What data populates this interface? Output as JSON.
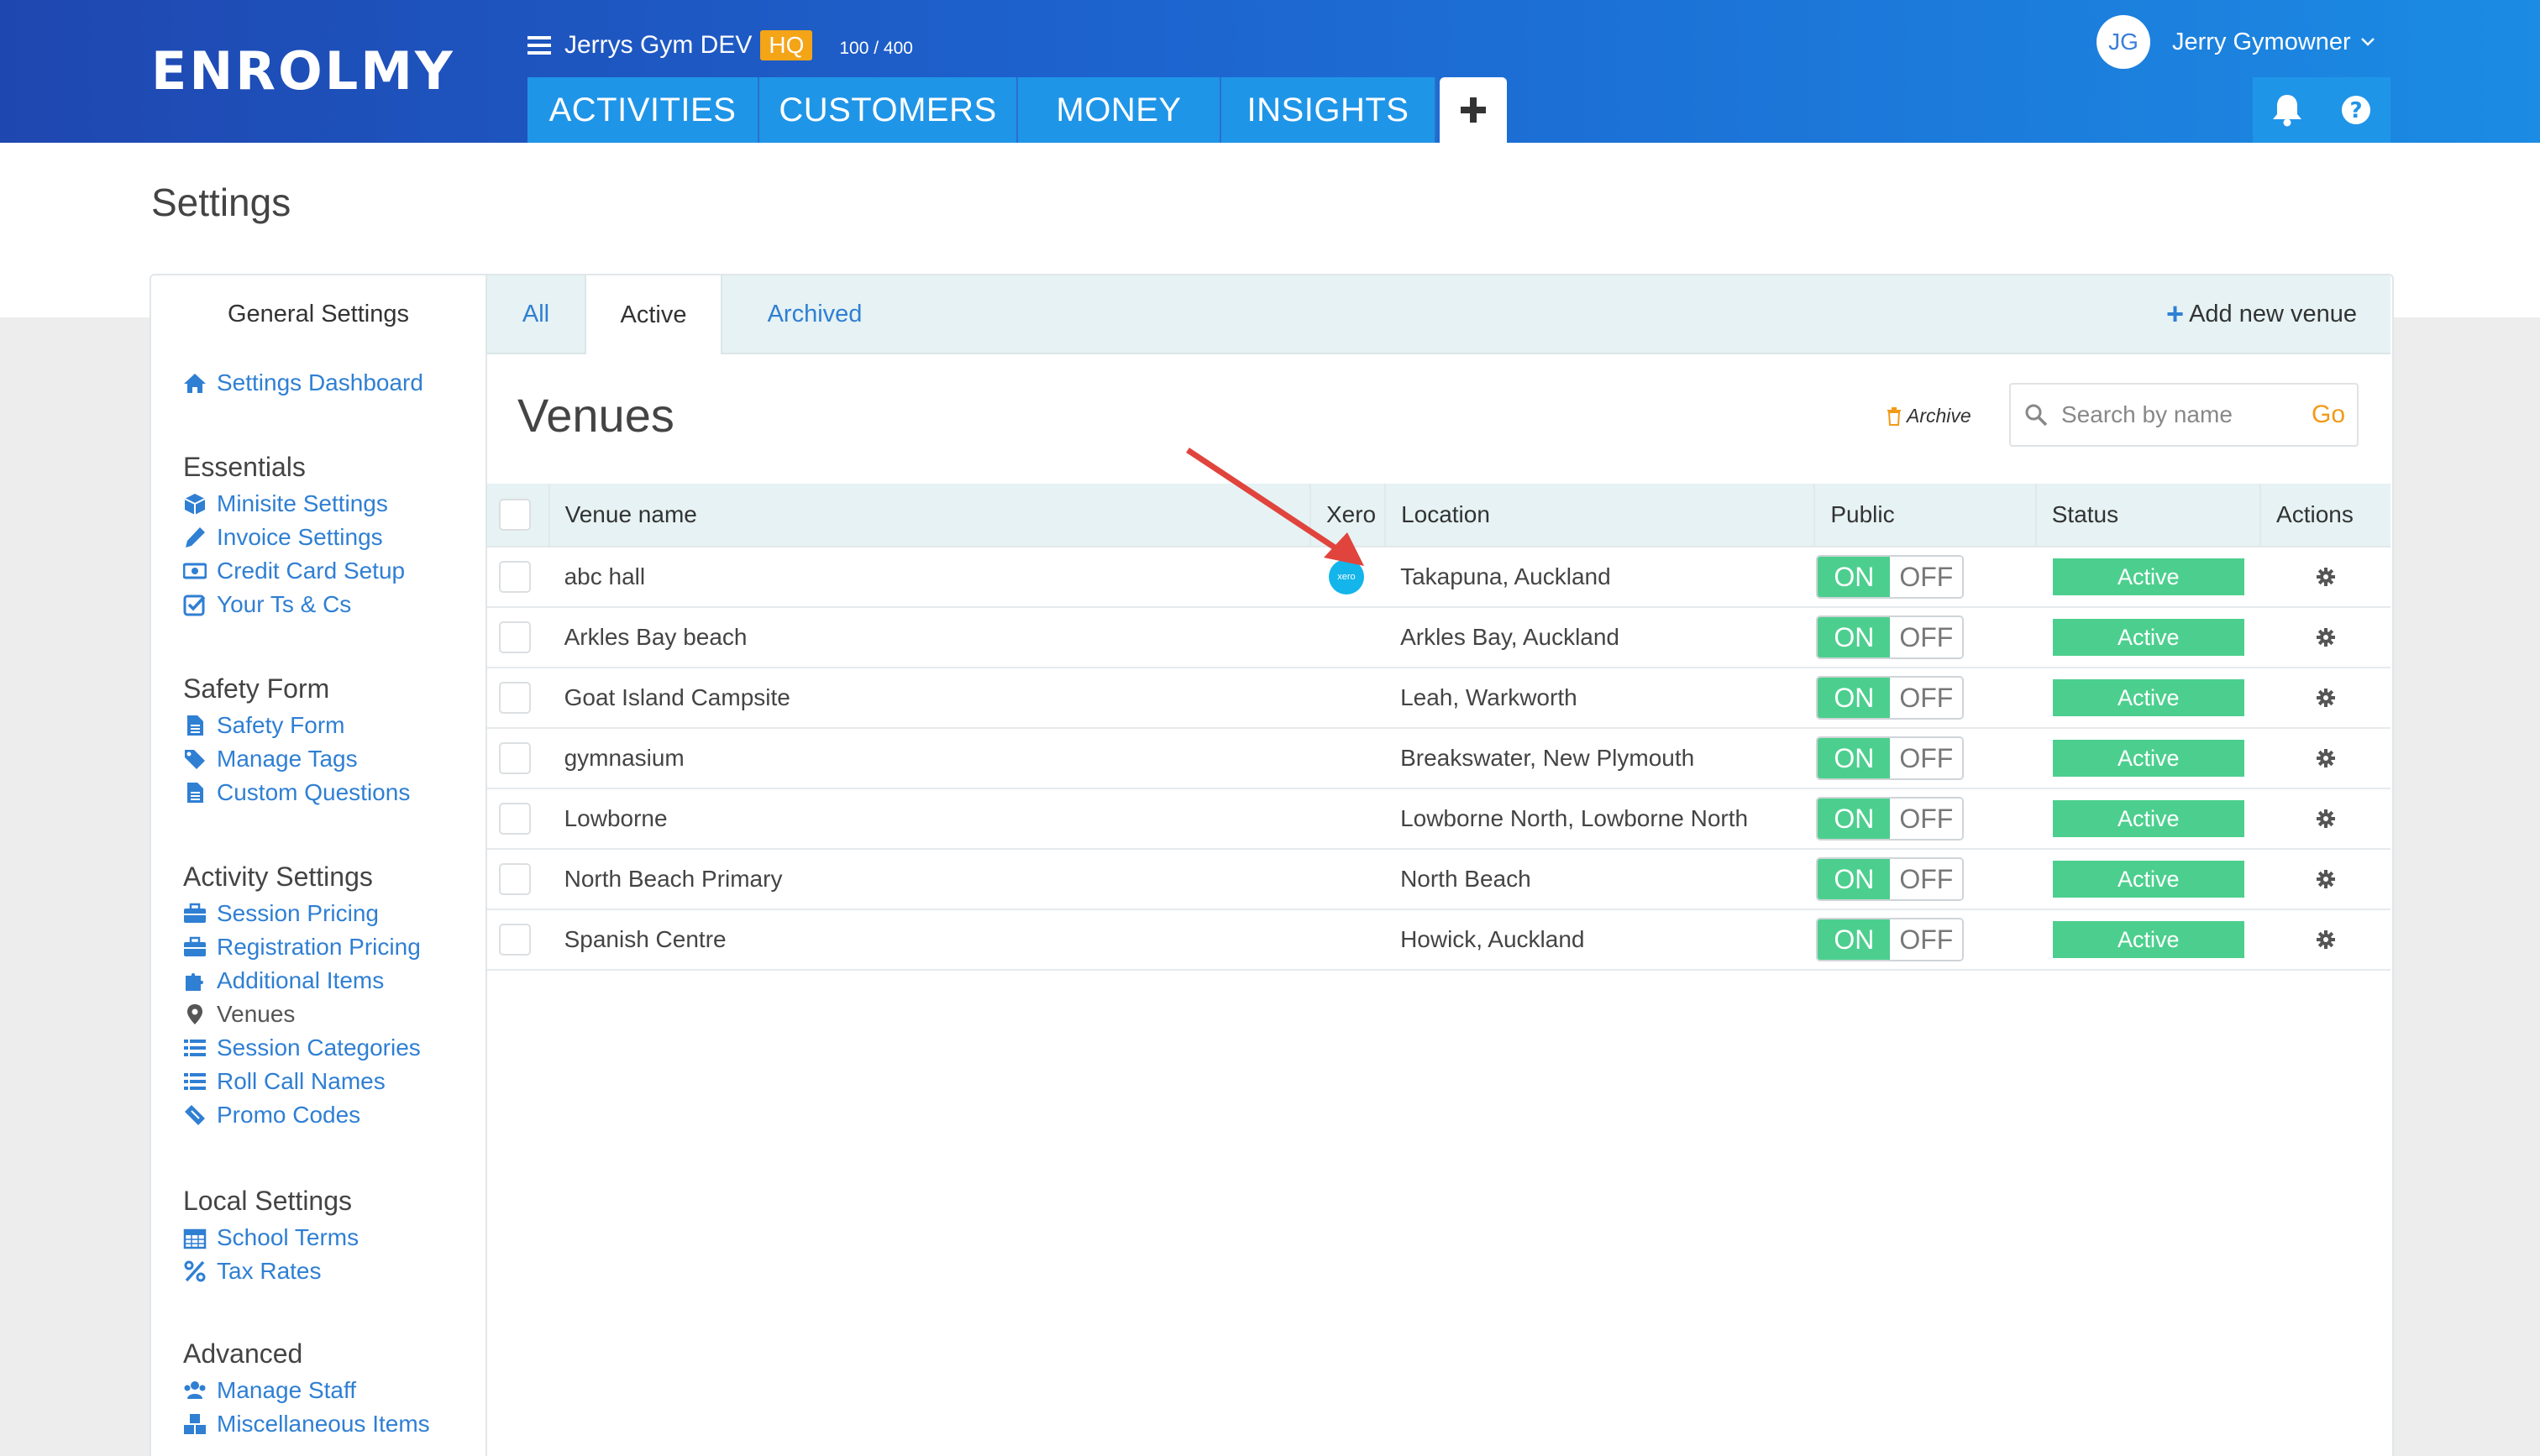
{
  "header": {
    "logo_text": "ENROLMY",
    "gym_name": "Jerrys Gym DEV",
    "hq_badge": "HQ",
    "capacity": "100 / 400",
    "tabs": [
      {
        "label": "ACTIVITIES"
      },
      {
        "label": "CUSTOMERS"
      },
      {
        "label": "MONEY"
      },
      {
        "label": "INSIGHTS"
      }
    ],
    "user_initials": "JG",
    "user_name": "Jerry Gymowner",
    "colors": {
      "gradient_start": "#1f47b0",
      "gradient_end": "#1b8be3",
      "tab_bg": "#1f95e8",
      "hq": "#f4a417"
    }
  },
  "page": {
    "title": "Settings"
  },
  "sidebar": {
    "title": "General Settings",
    "dashboard": {
      "label": "Settings Dashboard",
      "icon": "home-icon"
    },
    "sections": [
      {
        "heading": "Essentials",
        "items": [
          {
            "label": "Minisite Settings",
            "icon": "cube-icon"
          },
          {
            "label": "Invoice Settings",
            "icon": "pencil-icon"
          },
          {
            "label": "Credit Card Setup",
            "icon": "money-icon"
          },
          {
            "label": "Your Ts & Cs",
            "icon": "checkbox-icon"
          }
        ]
      },
      {
        "heading": "Safety Form",
        "items": [
          {
            "label": "Safety Form",
            "icon": "file-icon"
          },
          {
            "label": "Manage Tags",
            "icon": "tags-icon"
          },
          {
            "label": "Custom Questions",
            "icon": "file-icon"
          }
        ]
      },
      {
        "heading": "Activity Settings",
        "items": [
          {
            "label": "Session Pricing",
            "icon": "briefcase-icon"
          },
          {
            "label": "Registration Pricing",
            "icon": "briefcase-icon"
          },
          {
            "label": "Additional Items",
            "icon": "puzzle-icon"
          },
          {
            "label": "Venues",
            "icon": "map-marker-icon"
          },
          {
            "label": "Session Categories",
            "icon": "list-icon"
          },
          {
            "label": "Roll Call Names",
            "icon": "list-icon"
          },
          {
            "label": "Promo Codes",
            "icon": "ticket-icon"
          }
        ]
      },
      {
        "heading": "Local Settings",
        "items": [
          {
            "label": "School Terms",
            "icon": "calendar-icon"
          },
          {
            "label": "Tax Rates",
            "icon": "percent-icon"
          }
        ]
      },
      {
        "heading": "Advanced",
        "items": [
          {
            "label": "Manage Staff",
            "icon": "users-icon"
          },
          {
            "label": "Miscellaneous Items",
            "icon": "cubes-icon"
          }
        ]
      }
    ]
  },
  "subtabs": [
    {
      "label": "All"
    },
    {
      "label": "Active"
    },
    {
      "label": "Archived"
    }
  ],
  "add_venue_label": "Add new venue",
  "venues": {
    "title": "Venues",
    "archive_label": "Archive",
    "search_placeholder": "Search by name",
    "go_label": "Go",
    "columns": {
      "name": "Venue name",
      "xero": "Xero",
      "location": "Location",
      "public": "Public",
      "status": "Status",
      "actions": "Actions"
    },
    "toggle_on": "ON",
    "toggle_off": "OFF",
    "xero_badge": "xero",
    "rows": [
      {
        "name": "abc hall",
        "location": "Takapuna, Auckland",
        "status": "Active",
        "xero": true
      },
      {
        "name": "Arkles Bay beach",
        "location": "Arkles Bay, Auckland",
        "status": "Active",
        "xero": false
      },
      {
        "name": "Goat Island Campsite",
        "location": "Leah, Warkworth",
        "status": "Active",
        "xero": false
      },
      {
        "name": "gymnasium",
        "location": "Breakswater, New Plymouth",
        "status": "Active",
        "xero": false
      },
      {
        "name": "Lowborne",
        "location": "Lowborne North, Lowborne North",
        "status": "Active",
        "xero": false
      },
      {
        "name": "North Beach Primary",
        "location": "North Beach",
        "status": "Active",
        "xero": false
      },
      {
        "name": "Spanish Centre",
        "location": "Howick, Auckland",
        "status": "Active",
        "xero": false
      }
    ],
    "colors": {
      "active": "#4ccf8e",
      "link": "#2f7fd3",
      "go": "#f29a17",
      "arrow": "#e0443c"
    }
  }
}
